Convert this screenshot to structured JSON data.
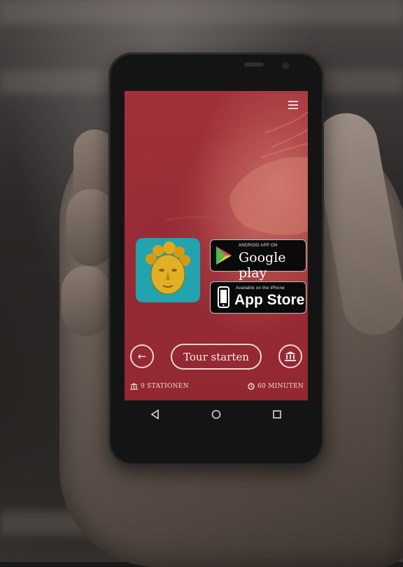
{
  "screen": {
    "stores": {
      "google_small": "ANDROID APP ON",
      "google_big": "Google play",
      "apple_small": "Available on the iPhone",
      "apple_big": "App Store"
    },
    "tour_button": "Tour starten",
    "stats": {
      "stations": "9 STATIONEN",
      "duration": "60 MINUTEN"
    }
  },
  "colors": {
    "screen_bg": "#9e2d35",
    "app_icon_bg": "#22a3ad",
    "outline": "#f3d6d6"
  },
  "icons": [
    "menu-icon",
    "back-arrow-icon",
    "museum-icon",
    "clock-icon",
    "android-back-icon",
    "android-home-icon",
    "android-recents-icon",
    "google-play-logo-icon",
    "iphone-icon"
  ]
}
